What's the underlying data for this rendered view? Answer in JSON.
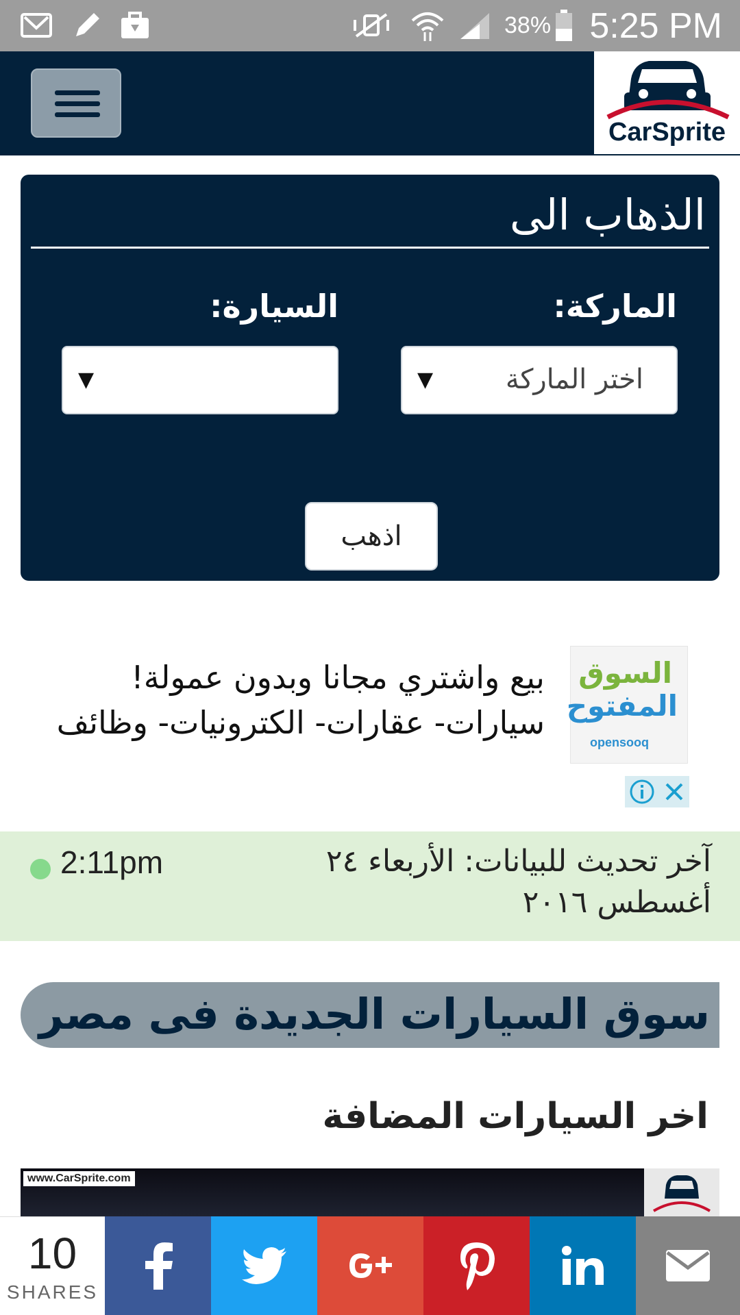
{
  "status_bar": {
    "time": "5:25 PM",
    "battery": "38%"
  },
  "header": {
    "logo_text": "CarSprite",
    "colors": {
      "navy": "#03213b",
      "logo_red": "#c8102e"
    }
  },
  "goto_panel": {
    "title": "الذهاب الى",
    "brand_label": "الماركة:",
    "brand_value": "اختر الماركة",
    "car_label": "السيارة:",
    "car_value": "",
    "go_button": "اذهب"
  },
  "ad": {
    "logo_ar_line1": "السوق",
    "logo_ar_line2": "المفتوح",
    "logo_en": "opensooq",
    "line1": "بيع واشتري مجانا وبدون عمولة!",
    "line2": "سيارات- عقارات- الكترونيات- وظائف"
  },
  "update": {
    "text": "آخر تحديث للبيانات: الأربعاء ٢٤ أغسطس ٢٠١٦",
    "time": "2:11pm",
    "dot_color": "#86d98c"
  },
  "section_title": "سوق السيارات الجديدة فى مصر",
  "latest_title": "اخر السيارات المضافة",
  "image_watermark": "www.CarSprite.com",
  "share_bar": {
    "count": "10",
    "count_label": "SHARES",
    "buttons": [
      {
        "icon": "facebook-icon",
        "color": "#3b5998"
      },
      {
        "icon": "twitter-icon",
        "color": "#1da1f2"
      },
      {
        "icon": "google-plus-icon",
        "color": "#dd4b39"
      },
      {
        "icon": "pinterest-icon",
        "color": "#cb2027"
      },
      {
        "icon": "linkedin-icon",
        "color": "#0077b5"
      },
      {
        "icon": "email-icon",
        "color": "#848484"
      }
    ]
  }
}
